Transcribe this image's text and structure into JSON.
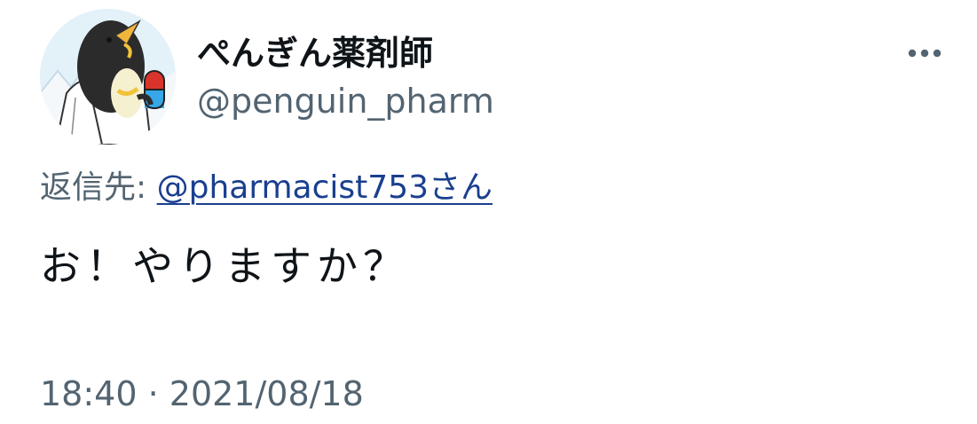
{
  "author": {
    "display_name": "ぺんぎん薬剤師",
    "handle": "@penguin_pharm",
    "avatar_icon": "penguin-pharmacist-avatar"
  },
  "more_icon": "more-horizontal-icon",
  "reply": {
    "prefix": "返信先:",
    "mention": "@pharmacist753",
    "suffix": "さん"
  },
  "tweet": {
    "text": "お！やりますか？"
  },
  "meta": {
    "time": "18:40",
    "separator": " · ",
    "date": "2021/08/18"
  },
  "colors": {
    "text_primary": "#0f1419",
    "text_secondary": "#536471",
    "link": "#1a3f8f"
  }
}
